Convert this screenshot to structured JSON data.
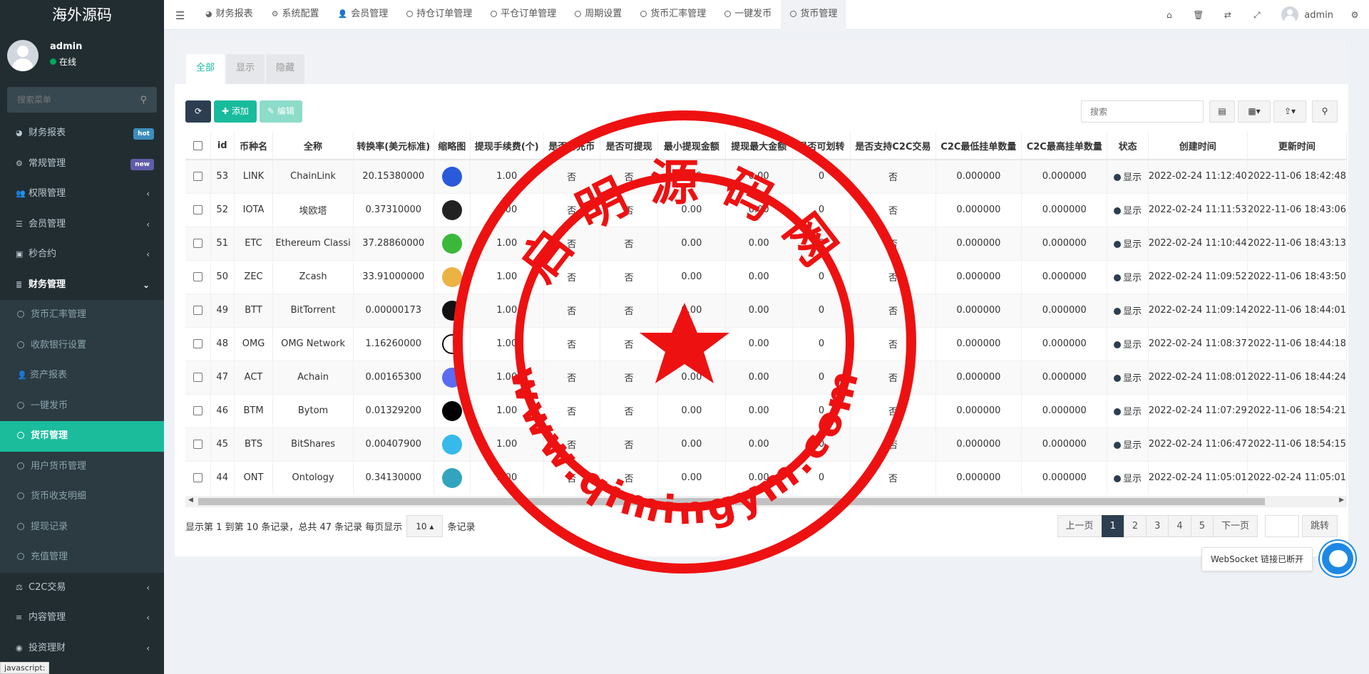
{
  "sidebar": {
    "logo": "海外源码",
    "user": {
      "name": "admin",
      "status": "在线"
    },
    "search_placeholder": "搜索菜单",
    "items": [
      {
        "label": "财务报表",
        "icon": "dashboard-icon",
        "badge": "hot",
        "badge_color": "#3c8dbc"
      },
      {
        "label": "常规管理",
        "icon": "cogs-icon",
        "badge": "new",
        "badge_color": "#605ca8"
      },
      {
        "label": "权限管理",
        "icon": "group-icon"
      },
      {
        "label": "会员管理",
        "icon": "list-icon"
      },
      {
        "label": "秒合约",
        "icon": "calendar-icon"
      },
      {
        "label": "财务管理",
        "icon": "database-icon",
        "open": true
      },
      {
        "label": "货币汇率管理",
        "sub": true
      },
      {
        "label": "收款银行设置",
        "sub": true
      },
      {
        "label": "资产报表",
        "sub": true,
        "icon": "user-icon"
      },
      {
        "label": "一键发币",
        "sub": true
      },
      {
        "label": "货币管理",
        "sub": true,
        "active": true
      },
      {
        "label": "用户货币管理",
        "sub": true
      },
      {
        "label": "货币收支明细",
        "sub": true
      },
      {
        "label": "提现记录",
        "sub": true
      },
      {
        "label": "充值管理",
        "sub": true
      },
      {
        "label": "C2C交易",
        "icon": "balance-scale-icon"
      },
      {
        "label": "内容管理",
        "icon": "align-left-icon"
      },
      {
        "label": "投资理财",
        "icon": "compass-icon"
      }
    ],
    "browser_status": "javascript:"
  },
  "topbar": {
    "tabs": [
      {
        "label": "财务报表",
        "icon": "dashboard-icon"
      },
      {
        "label": "系统配置",
        "icon": "gear-icon"
      },
      {
        "label": "会员管理",
        "icon": "user-icon"
      },
      {
        "label": "持仓订单管理",
        "icon": "circle-icon"
      },
      {
        "label": "平仓订单管理",
        "icon": "circle-icon"
      },
      {
        "label": "周期设置",
        "icon": "circle-icon"
      },
      {
        "label": "货币汇率管理",
        "icon": "circle-icon"
      },
      {
        "label": "一键发币",
        "icon": "circle-icon"
      },
      {
        "label": "货币管理",
        "icon": "circle-icon",
        "active": true
      }
    ],
    "admin_name": "admin"
  },
  "panel": {
    "tabs": [
      {
        "label": "全部",
        "active": true
      },
      {
        "label": "显示"
      },
      {
        "label": "隐藏"
      }
    ],
    "toolbar": {
      "add": "添加",
      "edit": "编辑"
    },
    "search_placeholder": "搜索"
  },
  "table": {
    "headers": [
      "id",
      "币种名",
      "全称",
      "转换率(美元标准)",
      "缩略图",
      "提现手续费(个)",
      "是否可充币",
      "是否可提现",
      "最小提现金额",
      "提现最大金额",
      "是否可划转",
      "是否支持C2C交易",
      "C2C最低挂单数量",
      "C2C最高挂单数量",
      "状态",
      "创建时间",
      "更新时间"
    ],
    "rows": [
      {
        "id": "53",
        "name": "LINK",
        "full": "ChainLink",
        "rate": "20.15380000",
        "thumb_color": "#2a5ada",
        "fee": "1.00",
        "deposit": "否",
        "withdraw": "否",
        "min": "0.00",
        "max": "0.00",
        "transfer": "0",
        "c2c": "否",
        "c2c_min": "0.000000",
        "c2c_max": "0.000000",
        "status": "显示",
        "created": "2022-02-24 11:12:40",
        "updated": "2022-11-06 18:42:48"
      },
      {
        "id": "52",
        "name": "IOTA",
        "full": "埃欧塔",
        "rate": "0.37310000",
        "thumb_color": "#222222",
        "fee": "1.00",
        "deposit": "否",
        "withdraw": "否",
        "min": "0.00",
        "max": "0.00",
        "transfer": "0",
        "c2c": "否",
        "c2c_min": "0.000000",
        "c2c_max": "0.000000",
        "status": "显示",
        "created": "2022-02-24 11:11:53",
        "updated": "2022-11-06 18:43:06"
      },
      {
        "id": "51",
        "name": "ETC",
        "full": "Ethereum Classi",
        "rate": "37.28860000",
        "thumb_color": "#3ab83a",
        "fee": "1.00",
        "deposit": "否",
        "withdraw": "否",
        "min": "0.00",
        "max": "0.00",
        "transfer": "0",
        "c2c": "否",
        "c2c_min": "0.000000",
        "c2c_max": "0.000000",
        "status": "显示",
        "created": "2022-02-24 11:10:44",
        "updated": "2022-11-06 18:43:13"
      },
      {
        "id": "50",
        "name": "ZEC",
        "full": "Zcash",
        "rate": "33.91000000",
        "thumb_color": "#ecb244",
        "fee": "1.00",
        "deposit": "否",
        "withdraw": "否",
        "min": "0.00",
        "max": "0.00",
        "transfer": "0",
        "c2c": "否",
        "c2c_min": "0.000000",
        "c2c_max": "0.000000",
        "status": "显示",
        "created": "2022-02-24 11:09:52",
        "updated": "2022-11-06 18:43:50"
      },
      {
        "id": "49",
        "name": "BTT",
        "full": "BitTorrent",
        "rate": "0.00000173",
        "thumb_color": "#111111",
        "fee": "1.00",
        "deposit": "否",
        "withdraw": "否",
        "min": "0.00",
        "max": "0.00",
        "transfer": "0",
        "c2c": "否",
        "c2c_min": "0.000000",
        "c2c_max": "0.000000",
        "status": "显示",
        "created": "2022-02-24 11:09:14",
        "updated": "2022-11-06 18:44:01"
      },
      {
        "id": "48",
        "name": "OMG",
        "full": "OMG Network",
        "rate": "1.16260000",
        "thumb_color": "#ffffff",
        "fee": "1.00",
        "deposit": "否",
        "withdraw": "否",
        "min": "0.00",
        "max": "0.00",
        "transfer": "0",
        "c2c": "否",
        "c2c_min": "0.000000",
        "c2c_max": "0.000000",
        "status": "显示",
        "created": "2022-02-24 11:08:37",
        "updated": "2022-11-06 18:44:18"
      },
      {
        "id": "47",
        "name": "ACT",
        "full": "Achain",
        "rate": "0.00165300",
        "thumb_color": "#5b6cf2",
        "fee": "1.00",
        "deposit": "否",
        "withdraw": "否",
        "min": "0.00",
        "max": "0.00",
        "transfer": "0",
        "c2c": "否",
        "c2c_min": "0.000000",
        "c2c_max": "0.000000",
        "status": "显示",
        "created": "2022-02-24 11:08:01",
        "updated": "2022-11-06 18:44:24"
      },
      {
        "id": "46",
        "name": "BTM",
        "full": "Bytom",
        "rate": "0.01329200",
        "thumb_color": "#000000",
        "fee": "1.00",
        "deposit": "否",
        "withdraw": "否",
        "min": "0.00",
        "max": "0.00",
        "transfer": "0",
        "c2c": "否",
        "c2c_min": "0.000000",
        "c2c_max": "0.000000",
        "status": "显示",
        "created": "2022-02-24 11:07:29",
        "updated": "2022-11-06 18:54:21"
      },
      {
        "id": "45",
        "name": "BTS",
        "full": "BitShares",
        "rate": "0.00407900",
        "thumb_color": "#35baeb",
        "fee": "1.00",
        "deposit": "否",
        "withdraw": "否",
        "min": "0.00",
        "max": "0.00",
        "transfer": "0",
        "c2c": "否",
        "c2c_min": "0.000000",
        "c2c_max": "0.000000",
        "status": "显示",
        "created": "2022-02-24 11:06:47",
        "updated": "2022-11-06 18:54:15"
      },
      {
        "id": "44",
        "name": "ONT",
        "full": "Ontology",
        "rate": "0.34130000",
        "thumb_color": "#32a4be",
        "fee": "1.00",
        "deposit": "否",
        "withdraw": "否",
        "min": "0.00",
        "max": "0.00",
        "transfer": "0",
        "c2c": "否",
        "c2c_min": "0.000000",
        "c2c_max": "0.000000",
        "status": "显示",
        "created": "2022-02-24 11:05:01",
        "updated": "2022-02-24 11:05:01"
      }
    ]
  },
  "pagination": {
    "info_prefix": "显示第 1 到第 10 条记录，总共 47 条记录 每页显示",
    "page_size": "10",
    "info_suffix": "条记录",
    "prev": "上一页",
    "pages": [
      "1",
      "2",
      "3",
      "4",
      "5"
    ],
    "current": "1",
    "next": "下一页",
    "jump": "跳转"
  },
  "websocket": {
    "tip": "WebSocket 链接已断开"
  },
  "watermark": {
    "top_text": "启明源码网",
    "bottom_text": "www.qimingym.com",
    "color": "#ee1111"
  },
  "colors": {
    "accent": "#18bc9c",
    "sidebar": "#222d32",
    "dark": "#2c3e50"
  }
}
